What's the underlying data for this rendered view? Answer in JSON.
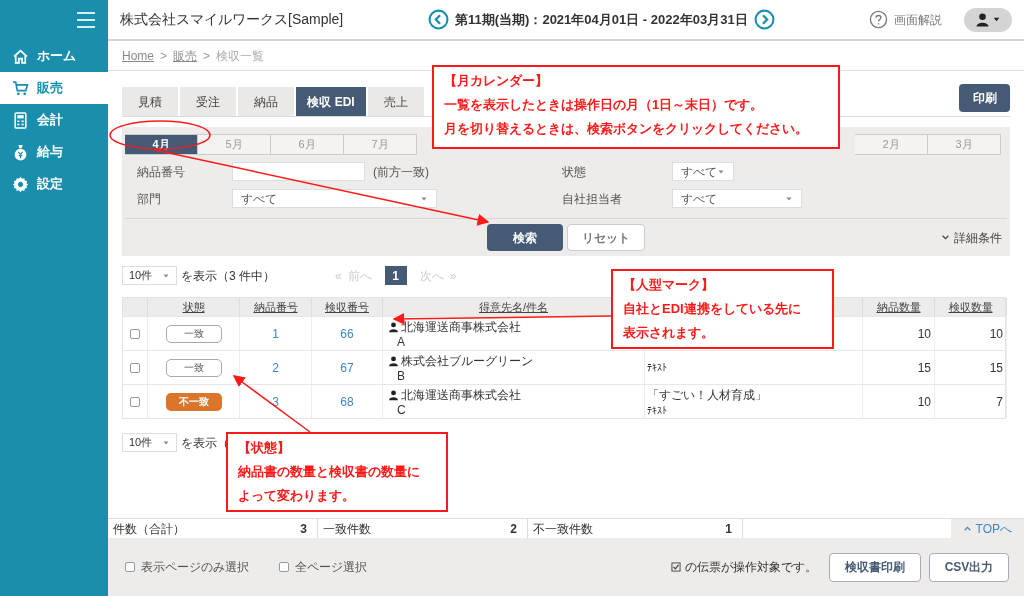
{
  "sidebar": {
    "items": [
      {
        "label": "ホーム",
        "kind": "home",
        "selected": false
      },
      {
        "label": "販売",
        "kind": "cart",
        "selected": true
      },
      {
        "label": "会計",
        "kind": "calculator",
        "selected": false
      },
      {
        "label": "給与",
        "kind": "moneybag",
        "selected": false
      },
      {
        "label": "設定",
        "kind": "gear",
        "selected": false
      }
    ]
  },
  "header": {
    "company": "株式会社スマイルワークス[Sample]",
    "period": "第11期(当期)：2021年04月01日 - 2022年03月31日",
    "help": "画面解説"
  },
  "breadcrumb": [
    {
      "label": "Home",
      "link": true
    },
    {
      "separator": ">",
      "label": "販売",
      "link": true
    },
    {
      "separator": ">",
      "label": "検収一覧",
      "link": false
    }
  ],
  "tabs": [
    {
      "label": "見積",
      "selected": false
    },
    {
      "label": "受注",
      "selected": false
    },
    {
      "label": "納品",
      "selected": false
    },
    {
      "label": "検収 EDI",
      "selected": true
    },
    {
      "label": "売上",
      "selected": false
    }
  ],
  "print_button": "印刷",
  "months": [
    {
      "label": "4月",
      "selected": true
    },
    {
      "label": "5月",
      "selected": false
    },
    {
      "label": "6月",
      "selected": false
    },
    {
      "label": "7月",
      "selected": false
    },
    {
      "label": "2月",
      "selected": false
    },
    {
      "label": "3月",
      "selected": false
    }
  ],
  "filters": [
    {
      "label": "納品番号",
      "kind": "text",
      "hint": "(前方一致)"
    },
    {
      "label": "状態",
      "kind": "select",
      "value": "すべて"
    },
    {
      "label": "部門",
      "kind": "select",
      "value": "すべて"
    },
    {
      "label": "自社担当者",
      "kind": "select",
      "value": "すべて"
    }
  ],
  "search_button": "検索",
  "reset_button": "リセット",
  "details_toggle": "詳細条件",
  "pager_top": {
    "page_size": "10件",
    "summary": "を表示（3 件中）",
    "prev_mark": "«",
    "prev": "前へ",
    "page": "1",
    "next": "次へ",
    "next_mark": "»"
  },
  "pager_bottom": {
    "page_size": "10件",
    "summary": "を表示（"
  },
  "table": {
    "columns": [
      "状態",
      "納品番号",
      "検収番号",
      "得意先名/件名",
      "納品数量",
      "検収数量"
    ],
    "rows": [
      {
        "checked": false,
        "status": "一致",
        "matched": true,
        "delivery_no": "1",
        "inspection_no": "66",
        "customer": "北海運送商事株式会社",
        "customer_sub": "A",
        "edi": true,
        "delivery_qty": "10",
        "inspection_qty": "10"
      },
      {
        "checked": false,
        "status": "一致",
        "matched": true,
        "delivery_no": "2",
        "inspection_no": "67",
        "customer": "株式会社ブルーグリーン",
        "customer_sub": "B",
        "edi": true,
        "subject_sub": "ﾃｷｽﾄ",
        "delivery_qty": "15",
        "inspection_qty": "15"
      },
      {
        "checked": false,
        "status": "不一致",
        "matched": false,
        "delivery_no": "3",
        "inspection_no": "68",
        "customer": "北海運送商事株式会社",
        "customer_sub": "C",
        "edi": true,
        "subject": "「すごい！人材育成」",
        "subject_sub": "ﾃｷｽﾄ",
        "delivery_qty": "10",
        "inspection_qty": "7"
      }
    ]
  },
  "summary": [
    {
      "label": "件数（合計）",
      "value": "3"
    },
    {
      "label": "一致件数",
      "value": "2"
    },
    {
      "label": "不一致件数",
      "value": "1"
    }
  ],
  "top_link": "TOPへ",
  "footer": {
    "select_options": [
      {
        "label": "表示ページのみ選択",
        "checked": false
      },
      {
        "label": "全ページ選択",
        "checked": false
      }
    ],
    "target_note": "の伝票が操作対象です。",
    "buttons": [
      "検収書印刷",
      "CSV出力"
    ]
  },
  "annotations": [
    {
      "title": "【月カレンダー】",
      "lines": [
        "一覧を表示したときは操作日の月（1日～末日）です。",
        "月を切り替えるときは、検索ボタンをクリックしてください。"
      ]
    },
    {
      "title": "【人型マーク】",
      "lines": [
        "自社とEDI連携をしている先に",
        "表示されます。"
      ]
    },
    {
      "title": "【状態】",
      "lines": [
        "納品書の数量と検収書の数量に",
        "よって変わります。"
      ]
    }
  ]
}
